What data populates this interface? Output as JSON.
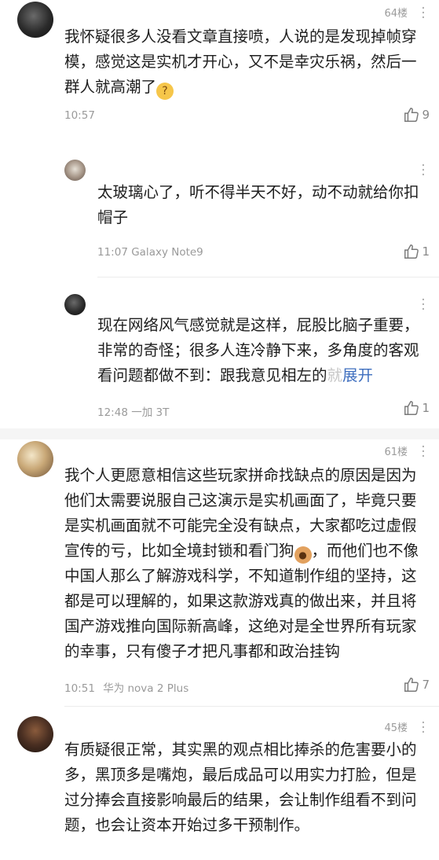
{
  "comments": [
    {
      "floor": "64楼",
      "text_part1": "我怀疑很多人没看文章直接喷，人说的是发现掉帧穿模，感觉这是实机才开心，又不是幸灾乐祸，然后一群人就高潮了",
      "emoji": "thinking-emoji",
      "time": "10:57",
      "device": "",
      "likes": "9",
      "replies": [
        {
          "text": "太玻璃心了，听不得半天不好，动不动就给你扣帽子",
          "time": "11:07",
          "device": "Galaxy Note9",
          "likes": "1"
        },
        {
          "text_main": "现在网络风气感觉就是这样，屁股比脑子重要，非常的奇怪；很多人连冷静下来，多角度的客观看问题都做不到：跟我意见相左的",
          "text_faded": "就",
          "expand": "展开",
          "time": "12:48",
          "device": "一加 3T",
          "likes": "1"
        }
      ]
    },
    {
      "floor": "61楼",
      "text_part1": "我个人更愿意相信这些玩家拼命找缺点的原因是因为他们太需要说服自己这演示是实机画面了，毕竟只要是实机画面就不可能完全没有缺点，大家都吃过虚假宣传的亏，比如全境封锁和看门狗",
      "emoji": "dog-emoji",
      "text_part2": "，而他们也不像中国人那么了解游戏科学，不知道制作组的坚持，这都是可以理解的，如果这款游戏真的做出来，并且将国产游戏推向国际新高峰，这绝对是全世界所有玩家的幸事，只有傻子才把凡事都和政治挂钩",
      "time": "10:51",
      "device": "华为 nova 2 Plus",
      "likes": "7"
    },
    {
      "floor": "45楼",
      "text_part1": "有质疑很正常，其实黑的观点相比捧杀的危害要小的多，黑顶多是嘴炮，最后成品可以用实力打脸，但是过分捧会直接影响最后的结果，会让制作组看不到问题，也会让资本开始过多干预制作。"
    }
  ]
}
